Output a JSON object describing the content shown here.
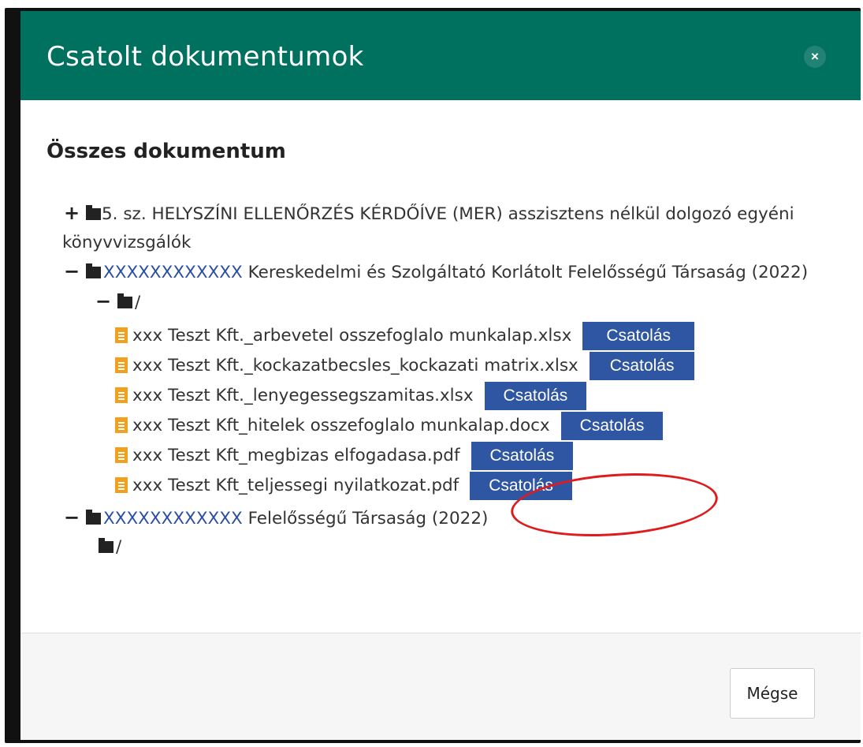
{
  "dialog": {
    "title": "Csatolt dokumentumok",
    "close_label": "×",
    "section_title": "Összes dokumentum",
    "cancel_label": "Mégse"
  },
  "tree": {
    "node1": {
      "toggle": "+",
      "label": "5. sz. HELYSZÍNI ELLENŐRZÉS KÉRDŐÍVE (MER) asszisztens nélkül dolgozó egyéni könyvvizsgálók"
    },
    "node2": {
      "toggle": "−",
      "prefix": "XXXXXXXXXXXX",
      "label": " Kereskedelmi és Szolgáltató Korlátolt Felelősségű Társaság (2022)"
    },
    "node2_sub": {
      "toggle": "−",
      "label": "/"
    },
    "files": [
      {
        "name": "xxx Teszt Kft._arbevetel osszefoglalo munkalap.xlsx",
        "button": "Csatolás"
      },
      {
        "name": "xxx Teszt Kft._kockazatbecsles_kockazati matrix.xlsx",
        "button": "Csatolás"
      },
      {
        "name": "xxx Teszt Kft._lenyegessegszamitas.xlsx",
        "button": "Csatolás"
      },
      {
        "name": "xxx Teszt Kft_hitelek osszefoglalo munkalap.docx",
        "button": "Csatolás"
      },
      {
        "name": "xxx Teszt Kft_megbizas elfogadasa.pdf",
        "button": "Csatolás"
      },
      {
        "name": "xxx Teszt Kft_teljessegi nyilatkozat.pdf",
        "button": "Csatolás"
      }
    ],
    "node3": {
      "toggle": "−",
      "prefix": "XXXXXXXXXXXX",
      "label": " Felelősségű Társaság (2022)"
    },
    "node3_sub": {
      "label": "/"
    }
  },
  "colors": {
    "header": "#00705f",
    "button": "#2f56a2",
    "file_icon": "#f2a11f",
    "highlight": "#e01b1b"
  }
}
